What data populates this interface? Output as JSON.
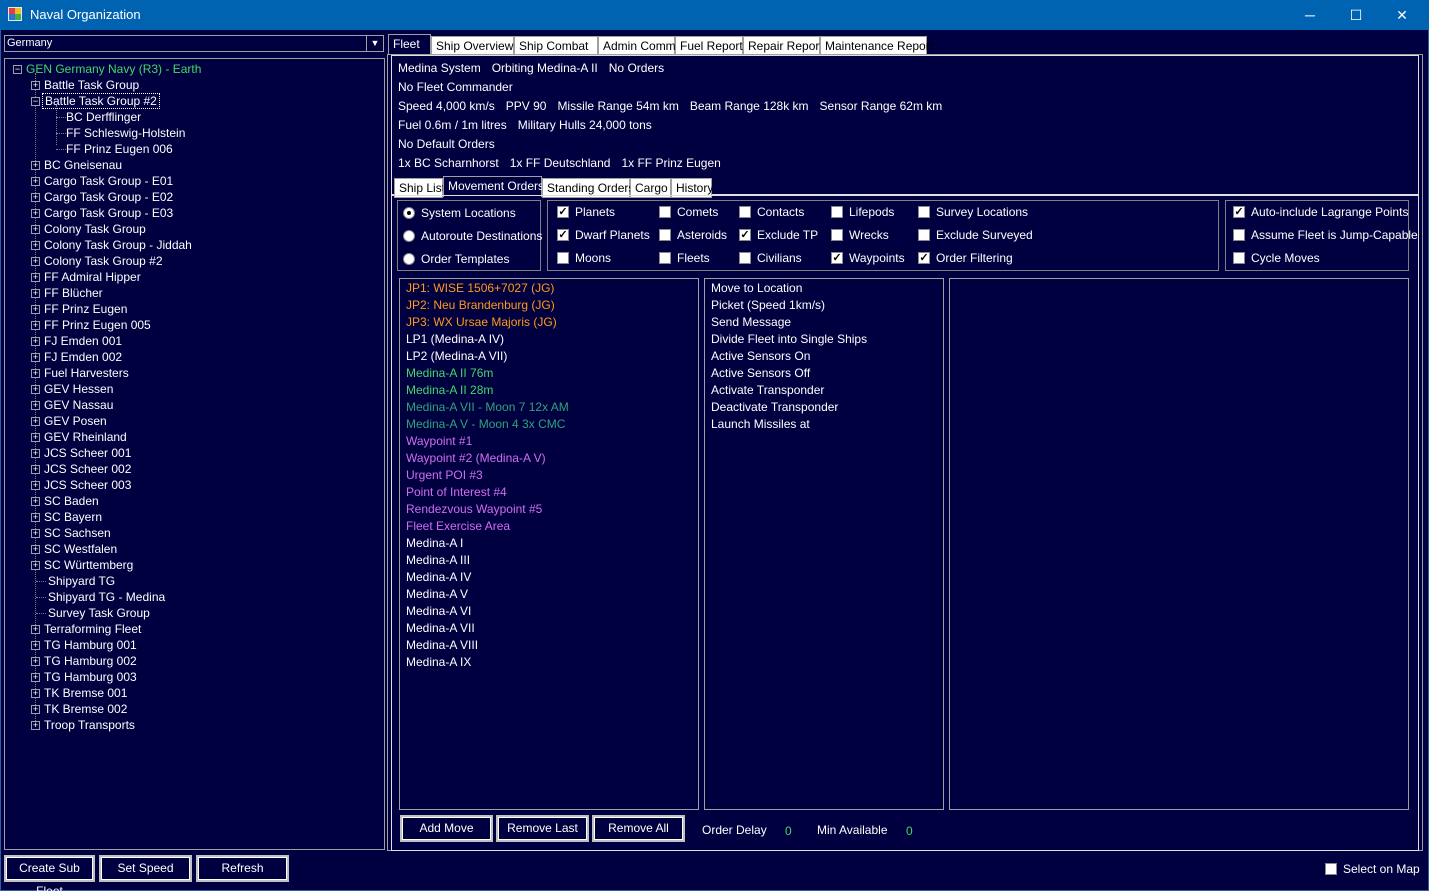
{
  "window": {
    "title": "Naval Organization",
    "minimize": "─",
    "maximize": "☐",
    "close": "✕"
  },
  "race_select": {
    "value": "Germany"
  },
  "tree": {
    "root": "GEN Germany Navy  (R3)  -  Earth",
    "items": [
      {
        "label": "Battle Task Group",
        "level": 1,
        "exp": "+"
      },
      {
        "label": "Battle Task Group #2",
        "level": 1,
        "exp": "−",
        "selected": true
      },
      {
        "label": "BC Derfflinger",
        "level": 2
      },
      {
        "label": "FF Schleswig-Holstein",
        "level": 2
      },
      {
        "label": "FF Prinz Eugen 006",
        "level": 2
      },
      {
        "label": "BC Gneisenau",
        "level": 1,
        "exp": "+"
      },
      {
        "label": "Cargo Task Group - E01",
        "level": 1,
        "exp": "+"
      },
      {
        "label": "Cargo Task Group - E02",
        "level": 1,
        "exp": "+"
      },
      {
        "label": "Cargo Task Group - E03",
        "level": 1,
        "exp": "+"
      },
      {
        "label": "Colony Task Group",
        "level": 1,
        "exp": "+"
      },
      {
        "label": "Colony Task Group - Jiddah",
        "level": 1,
        "exp": "+"
      },
      {
        "label": "Colony Task Group #2",
        "level": 1,
        "exp": "+"
      },
      {
        "label": "FF Admiral Hipper",
        "level": 1,
        "exp": "+"
      },
      {
        "label": "FF Blücher",
        "level": 1,
        "exp": "+"
      },
      {
        "label": "FF Prinz Eugen",
        "level": 1,
        "exp": "+"
      },
      {
        "label": "FF Prinz Eugen 005",
        "level": 1,
        "exp": "+"
      },
      {
        "label": "FJ Emden 001",
        "level": 1,
        "exp": "+"
      },
      {
        "label": "FJ Emden 002",
        "level": 1,
        "exp": "+"
      },
      {
        "label": "Fuel Harvesters",
        "level": 1,
        "exp": "+"
      },
      {
        "label": "GEV Hessen",
        "level": 1,
        "exp": "+"
      },
      {
        "label": "GEV Nassau",
        "level": 1,
        "exp": "+"
      },
      {
        "label": "GEV Posen",
        "level": 1,
        "exp": "+"
      },
      {
        "label": "GEV Rheinland",
        "level": 1,
        "exp": "+"
      },
      {
        "label": "JCS Scheer 001",
        "level": 1,
        "exp": "+"
      },
      {
        "label": "JCS Scheer 002",
        "level": 1,
        "exp": "+"
      },
      {
        "label": "JCS Scheer 003",
        "level": 1,
        "exp": "+"
      },
      {
        "label": "SC Baden",
        "level": 1,
        "exp": "+"
      },
      {
        "label": "SC Bayern",
        "level": 1,
        "exp": "+"
      },
      {
        "label": "SC Sachsen",
        "level": 1,
        "exp": "+"
      },
      {
        "label": "SC Westfalen",
        "level": 1,
        "exp": "+"
      },
      {
        "label": "SC Württemberg",
        "level": 1,
        "exp": "+"
      },
      {
        "label": "Shipyard TG",
        "level": 1
      },
      {
        "label": "Shipyard TG - Medina",
        "level": 1
      },
      {
        "label": "Survey Task Group",
        "level": 1
      },
      {
        "label": "Terraforming Fleet",
        "level": 1,
        "exp": "+"
      },
      {
        "label": "TG Hamburg 001",
        "level": 1,
        "exp": "+"
      },
      {
        "label": "TG Hamburg 002",
        "level": 1,
        "exp": "+"
      },
      {
        "label": "TG Hamburg 003",
        "level": 1,
        "exp": "+"
      },
      {
        "label": "TK Bremse 001",
        "level": 1,
        "exp": "+"
      },
      {
        "label": "TK Bremse 002",
        "level": 1,
        "exp": "+"
      },
      {
        "label": "Troop Transports",
        "level": 1,
        "exp": "+"
      }
    ]
  },
  "bottom_buttons": {
    "create_sub_fleet": "Create Sub Fleet",
    "set_speed": "Set Speed",
    "refresh": "Refresh"
  },
  "select_on_map": "Select on Map",
  "main_tabs": [
    "Fleet",
    "Ship Overview",
    "Ship Combat",
    "Admin Command",
    "Fuel Report",
    "Repair Report",
    "Maintenance Report"
  ],
  "fleet_info": {
    "line1": [
      "Medina System",
      "Orbiting Medina-A II",
      "No Orders"
    ],
    "line2": [
      "No Fleet Commander"
    ],
    "line3": [
      "Speed 4,000 km/s",
      "PPV 90",
      "Missile Range 54m  km",
      "Beam Range 128k  km",
      "Sensor Range 62m  km"
    ],
    "line4": [
      "Fuel 0.6m / 1m litres",
      "Military Hulls 24,000 tons"
    ],
    "line5": [
      "No Default Orders"
    ],
    "line6": [
      "1x BC Scharnhorst",
      "1x FF Deutschland",
      "1x FF Prinz Eugen"
    ]
  },
  "sub_tabs": [
    "Ship List",
    "Movement Orders",
    "Standing Orders",
    "Cargo",
    "History"
  ],
  "radio_options": [
    {
      "label": "System Locations",
      "on": true
    },
    {
      "label": "Autoroute Destinations",
      "on": false
    },
    {
      "label": "Order Templates",
      "on": false
    }
  ],
  "filters": [
    {
      "label": "Planets",
      "on": true
    },
    {
      "label": "Comets",
      "on": false
    },
    {
      "label": "Contacts",
      "on": false
    },
    {
      "label": "Lifepods",
      "on": false
    },
    {
      "label": "Survey Locations",
      "on": false
    },
    {
      "label": "Dwarf Planets",
      "on": true
    },
    {
      "label": "Asteroids",
      "on": false
    },
    {
      "label": "Exclude TP",
      "on": true
    },
    {
      "label": "Wrecks",
      "on": false
    },
    {
      "label": "Exclude Surveyed",
      "on": false
    },
    {
      "label": "Moons",
      "on": false
    },
    {
      "label": "Fleets",
      "on": false
    },
    {
      "label": "Civilians",
      "on": false
    },
    {
      "label": "Waypoints",
      "on": true
    },
    {
      "label": "Order Filtering",
      "on": true
    }
  ],
  "right_options": [
    {
      "label": "Auto-include Lagrange Points",
      "on": true
    },
    {
      "label": "Assume Fleet is Jump-Capable",
      "on": false
    },
    {
      "label": "Cycle Moves",
      "on": false
    }
  ],
  "locations": [
    {
      "label": "JP1: WISE 1506+7027 (JG)",
      "color": "orange"
    },
    {
      "label": "JP2: Neu Brandenburg (JG)",
      "color": "orange"
    },
    {
      "label": "JP3: WX Ursae Majoris (JG)",
      "color": "orange"
    },
    {
      "label": "LP1  (Medina-A IV)",
      "color": "white"
    },
    {
      "label": "LP2  (Medina-A VII)",
      "color": "white"
    },
    {
      "label": "Medina-A II  76m",
      "color": "green"
    },
    {
      "label": "Medina-A II  28m",
      "color": "green"
    },
    {
      "label": "Medina-A VII - Moon 7  12x AM",
      "color": "dkgreen"
    },
    {
      "label": "Medina-A V - Moon 4  3x CMC",
      "color": "dkgreen"
    },
    {
      "label": "Waypoint #1",
      "color": "violet"
    },
    {
      "label": "Waypoint #2  (Medina-A V)",
      "color": "violet"
    },
    {
      "label": "Urgent POI #3",
      "color": "violet"
    },
    {
      "label": "Point of Interest #4",
      "color": "violet"
    },
    {
      "label": "Rendezvous Waypoint #5",
      "color": "violet"
    },
    {
      "label": "Fleet Exercise Area",
      "color": "violet"
    },
    {
      "label": "Medina-A I",
      "color": "white"
    },
    {
      "label": "Medina-A III",
      "color": "white"
    },
    {
      "label": "Medina-A IV",
      "color": "white"
    },
    {
      "label": "Medina-A V",
      "color": "white"
    },
    {
      "label": "Medina-A VI",
      "color": "white"
    },
    {
      "label": "Medina-A VII",
      "color": "white"
    },
    {
      "label": "Medina-A VIII",
      "color": "white"
    },
    {
      "label": "Medina-A IX",
      "color": "white"
    }
  ],
  "actions": [
    "Move to Location",
    "Picket (Speed 1km/s)",
    "Send Message",
    "Divide Fleet into Single Ships",
    "Active Sensors On",
    "Active Sensors Off",
    "Activate Transponder",
    "Deactivate Transponder",
    "Launch Missiles at"
  ],
  "order_buttons": {
    "add_move": "Add Move",
    "remove_last": "Remove Last",
    "remove_all": "Remove All"
  },
  "order_delay": {
    "label": "Order Delay",
    "value": "0"
  },
  "min_available": {
    "label": "Min Available",
    "value": "0"
  }
}
